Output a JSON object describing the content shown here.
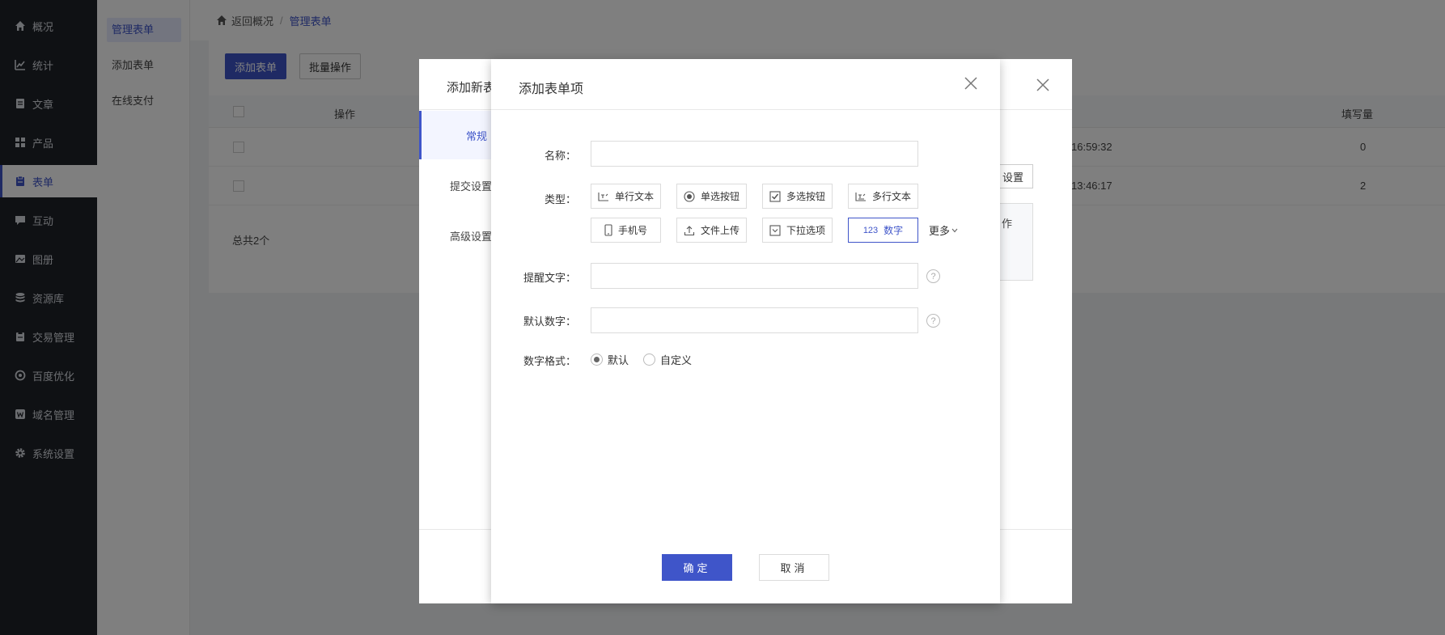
{
  "sidebar": {
    "items": [
      {
        "label": "概况",
        "icon": "home-icon"
      },
      {
        "label": "统计",
        "icon": "chart-icon"
      },
      {
        "label": "文章",
        "icon": "article-icon"
      },
      {
        "label": "产品",
        "icon": "product-icon"
      },
      {
        "label": "表单",
        "icon": "form-icon",
        "active": true
      },
      {
        "label": "互动",
        "icon": "chat-icon"
      },
      {
        "label": "图册",
        "icon": "album-icon"
      },
      {
        "label": "资源库",
        "icon": "database-icon"
      },
      {
        "label": "交易管理",
        "icon": "clipboard-icon"
      },
      {
        "label": "百度优化",
        "icon": "seo-icon"
      },
      {
        "label": "域名管理",
        "icon": "domain-icon"
      },
      {
        "label": "系统设置",
        "icon": "gear-icon"
      }
    ]
  },
  "subnav": {
    "items": [
      "管理表单",
      "添加表单",
      "在线支付"
    ]
  },
  "breadcrumb": {
    "back": "返回概况",
    "current": "管理表单"
  },
  "toolbar": {
    "add_label": "添加表单",
    "batch_label": "批量操作"
  },
  "table": {
    "headers": {
      "action": "操作",
      "count": "填写量"
    },
    "rows": [
      {
        "time": "16:59:32",
        "count": "0"
      },
      {
        "time": "13:46:17",
        "count": "2"
      }
    ],
    "total": "总共2个"
  },
  "outer_modal": {
    "title": "添加新表",
    "tabs": [
      "常规",
      "提交设置",
      "高级设置"
    ],
    "side_button": "设置",
    "side_box_text": "作"
  },
  "inner_modal": {
    "title": "添加表单项",
    "name_label": "名称：",
    "type_label": "类型：",
    "types": [
      {
        "label": "单行文本",
        "icon": "single-line-text-icon"
      },
      {
        "label": "单选按钮",
        "icon": "radio-icon"
      },
      {
        "label": "多选按钮",
        "icon": "checkbox-icon"
      },
      {
        "label": "多行文本",
        "icon": "multi-line-text-icon"
      },
      {
        "label": "手机号",
        "icon": "phone-icon"
      },
      {
        "label": "文件上传",
        "icon": "upload-icon"
      },
      {
        "label": "下拉选项",
        "icon": "dropdown-icon"
      },
      {
        "label": "数字",
        "icon": "number-icon",
        "prefix": "123",
        "selected": true
      }
    ],
    "more_label": "更多",
    "hint_label": "提醒文字：",
    "default_label": "默认数字：",
    "format_label": "数字格式：",
    "format_options": [
      {
        "label": "默认",
        "checked": true
      },
      {
        "label": "自定义",
        "checked": false
      }
    ],
    "help_glyph": "?",
    "confirm_label": "确定",
    "cancel_label": "取消"
  },
  "colors": {
    "primary": "#3f55c9",
    "sidebar_bg": "#1f2229",
    "mask": "rgba(0,0,0,0.5)"
  }
}
